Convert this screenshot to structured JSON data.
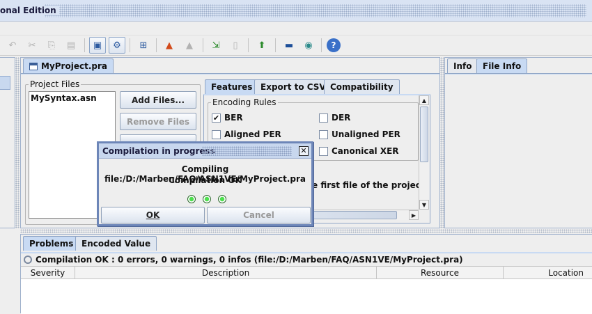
{
  "window": {
    "title": "onal Edition"
  },
  "toolbar": {
    "buttons": [
      {
        "icon": "undo-icon",
        "glyph": "↶",
        "enabled": false
      },
      {
        "icon": "cut-icon",
        "glyph": "✂",
        "enabled": false
      },
      {
        "icon": "copy-icon",
        "glyph": "⎘",
        "enabled": false
      },
      {
        "icon": "paste-icon",
        "glyph": "▤",
        "enabled": false
      },
      {
        "icon": "window-icon",
        "glyph": "▣",
        "enabled": true
      },
      {
        "icon": "settings-icon",
        "glyph": "⚙",
        "enabled": true
      },
      {
        "icon": "hierarchy-icon",
        "glyph": "⊞",
        "enabled": true
      },
      {
        "icon": "shapes-icon",
        "glyph": "▲",
        "enabled": true
      },
      {
        "icon": "shapes-disabled-icon",
        "glyph": "▲",
        "enabled": false
      },
      {
        "icon": "import-icon",
        "glyph": "⇲",
        "enabled": true
      },
      {
        "icon": "page-icon",
        "glyph": "▯",
        "enabled": false
      },
      {
        "icon": "build-icon",
        "glyph": "⬆",
        "enabled": true
      },
      {
        "icon": "monitor-icon",
        "glyph": "▬",
        "enabled": true
      },
      {
        "icon": "refresh-icon",
        "glyph": "◉",
        "enabled": true
      },
      {
        "icon": "help-icon",
        "glyph": "?",
        "enabled": true
      }
    ]
  },
  "editor": {
    "tab_label": "MyProject.pra",
    "project_files": {
      "legend": "Project Files",
      "files": [
        "MySyntax.asn"
      ]
    },
    "buttons": {
      "add_files": "Add Files...",
      "remove_files": "Remove Files"
    },
    "subtabs": [
      "Features",
      "Export to CSV",
      "Compatibility"
    ],
    "active_subtab": "Features",
    "encoding_rules": {
      "legend": "Encoding Rules",
      "options": [
        {
          "label": "BER",
          "checked": true
        },
        {
          "label": "DER",
          "checked": false
        },
        {
          "label": "Aligned PER",
          "checked": false
        },
        {
          "label": "Unaligned PER",
          "checked": false
        },
        {
          "label": "Canonical XER",
          "checked": false
        }
      ]
    },
    "hidden_text": "e first file of the project"
  },
  "right_panel": {
    "tabs": [
      "Info",
      "File Info"
    ],
    "active_tab": "File Info"
  },
  "bottom_panel": {
    "tabs": [
      "Problems",
      "Encoded Value"
    ],
    "active_tab": "Problems",
    "status": "Compilation OK : 0 errors, 0 warnings, 0 infos (file:/D:/Marben/FAQ/ASN1VE/MyProject.pra)",
    "columns": [
      "Severity",
      "Description",
      "Resource",
      "Location"
    ]
  },
  "dialog": {
    "title": "Compilation in progress",
    "message_line1": "Compiling file:/D:/Marben/FAQ/ASN1VE/MyProject.pra",
    "message_line2": "Compilation OK",
    "progress_dots": 3,
    "ok_label": "OK",
    "cancel_label": "Cancel",
    "close_glyph": "✕"
  }
}
